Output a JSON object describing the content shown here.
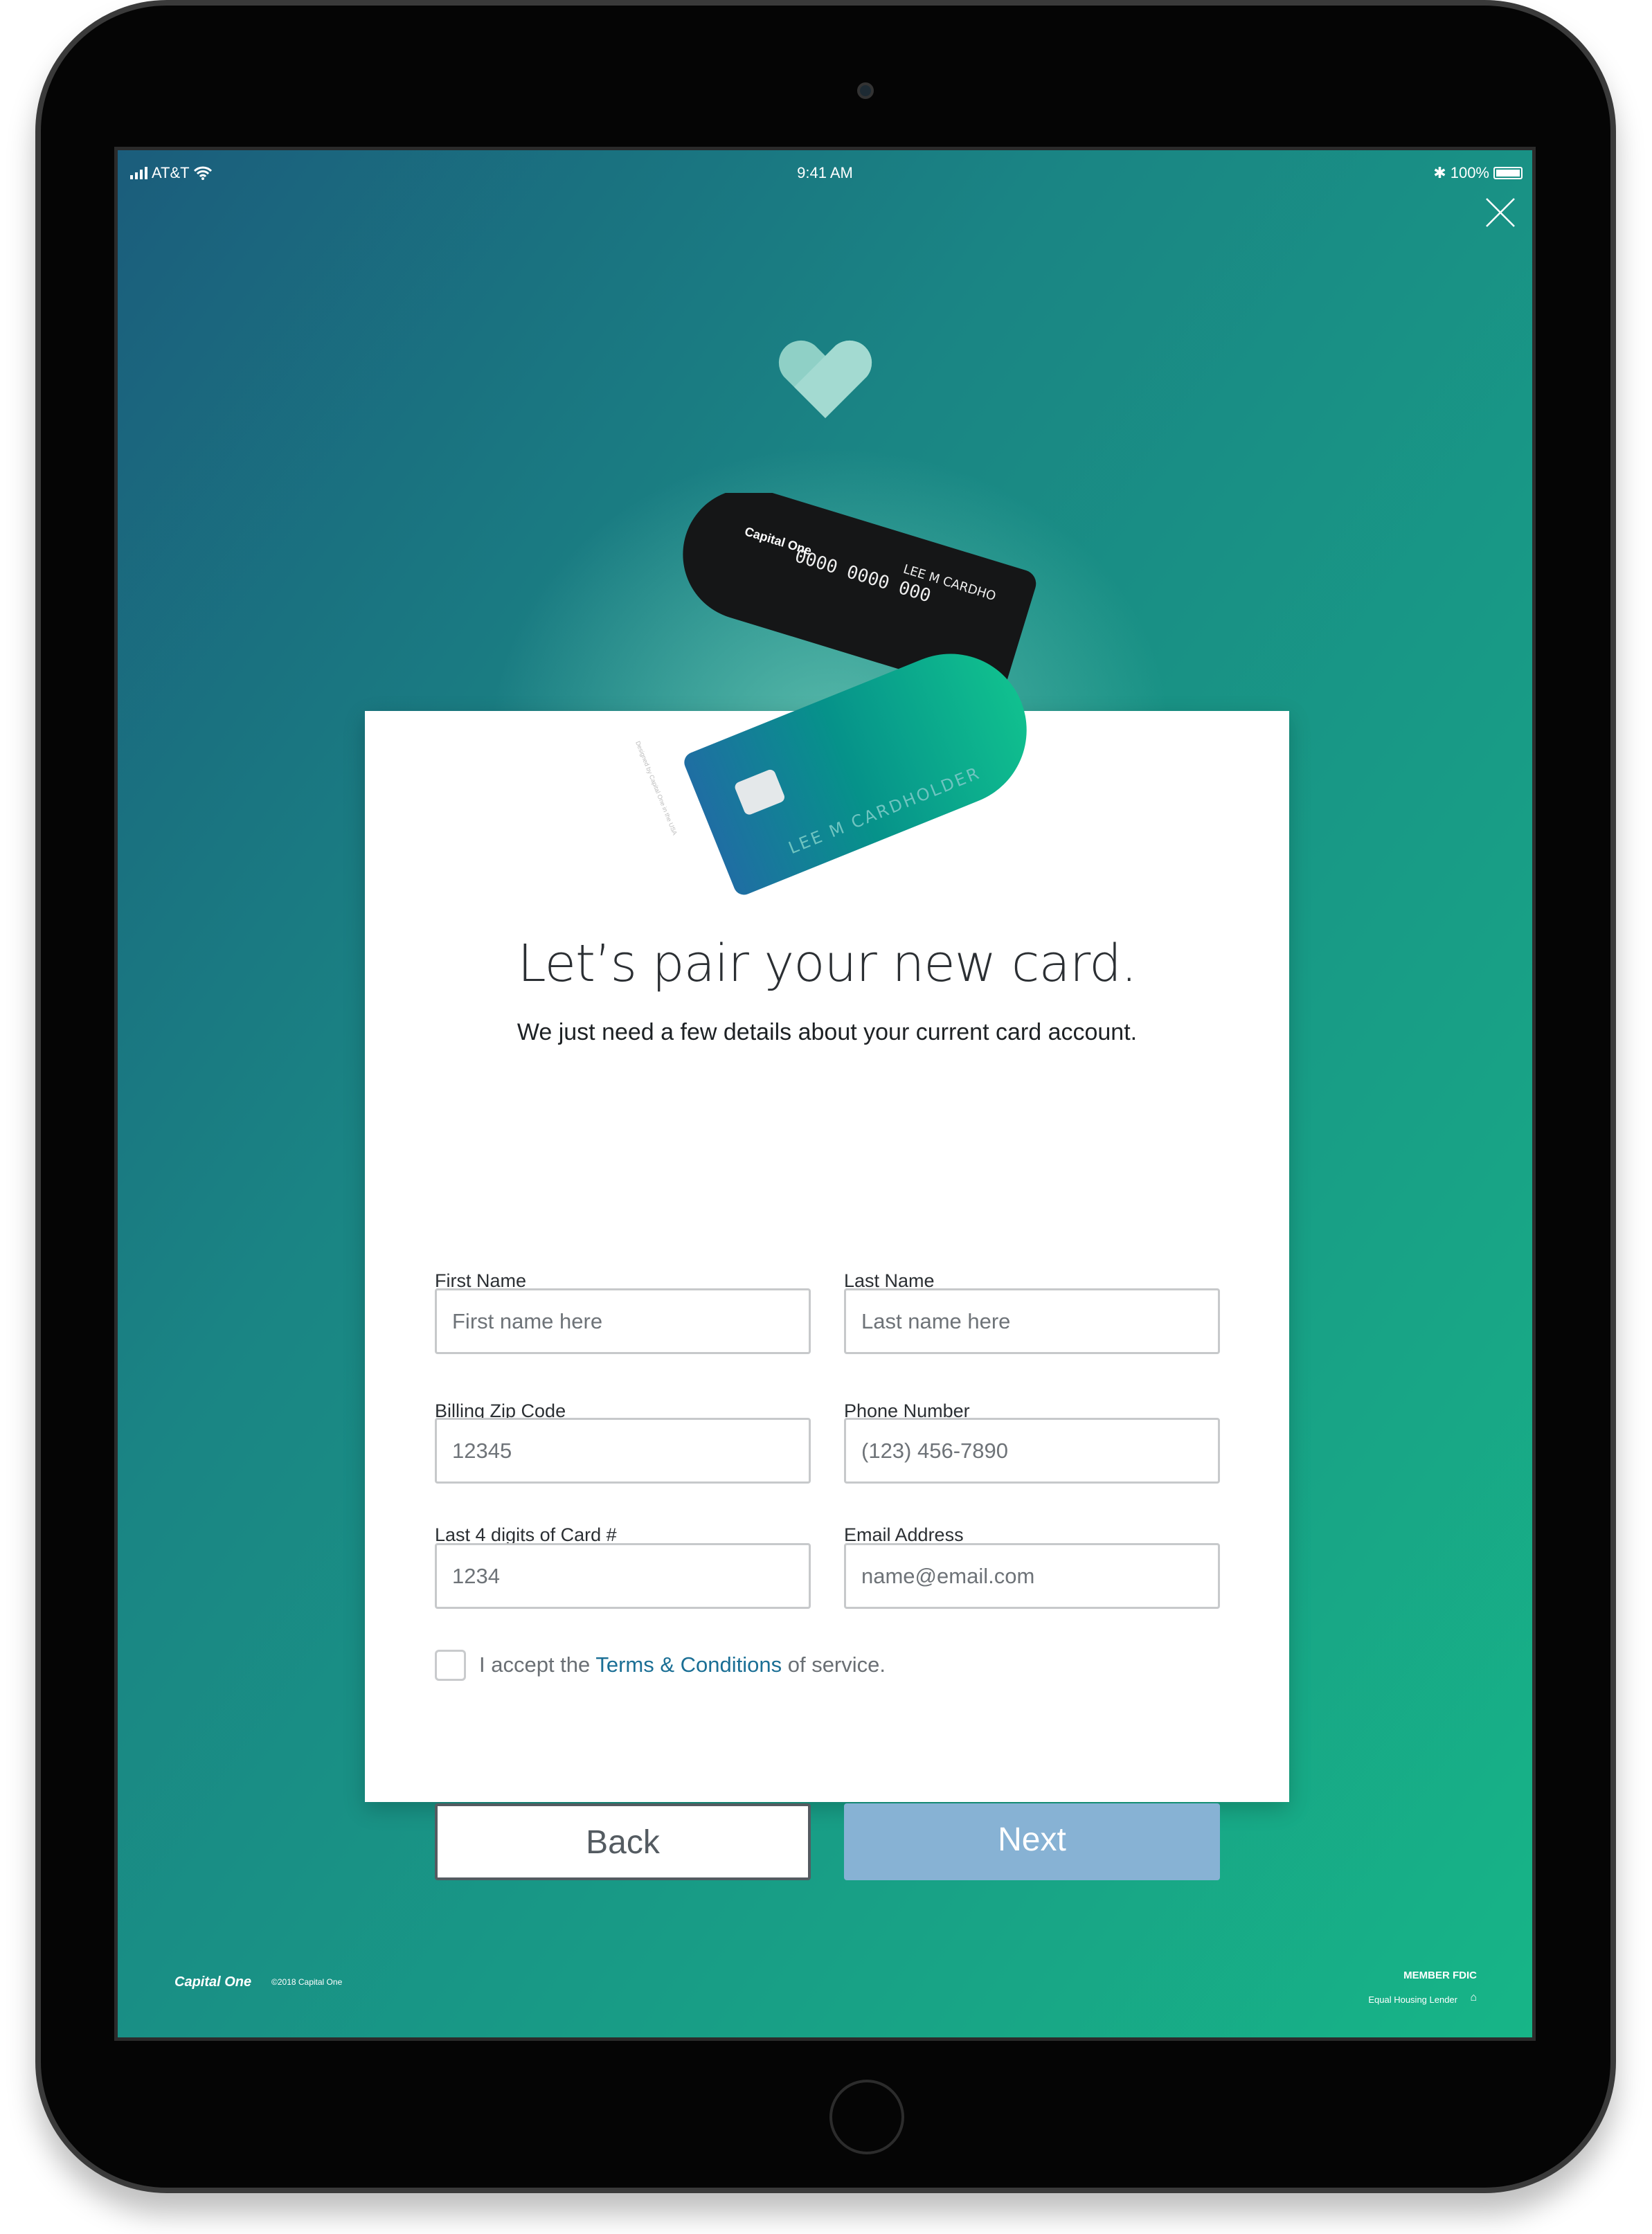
{
  "status_bar": {
    "carrier": "AT&T",
    "time": "9:41 AM",
    "battery": "100%"
  },
  "icons": {
    "close": "close-icon",
    "heart": "heart-icon"
  },
  "cards": {
    "back_card": {
      "brand": "Capital One",
      "number": "0000 0000 000",
      "name": "LEE M CARDHO",
      "side_text": "Designed by Capital One in the USA"
    },
    "front_card": {
      "name": "LEE M CARDHOLDER"
    }
  },
  "form": {
    "title": "Let’s pair your new card.",
    "subtitle": "We just need a few details about your current card account.",
    "fields": [
      {
        "label": "First Name",
        "placeholder": "First name here"
      },
      {
        "label": "Last Name",
        "placeholder": "Last name here"
      },
      {
        "label": "Billing Zip Code",
        "placeholder": "12345"
      },
      {
        "label": "Phone Number",
        "placeholder": "(123) 456-7890"
      },
      {
        "label": "Last 4 digits of Card #",
        "placeholder": "1234"
      },
      {
        "label": "Email Address",
        "placeholder": "name@email.com"
      }
    ],
    "terms": {
      "prefix": "I accept the ",
      "link": "Terms & Conditions",
      "suffix": " of service.",
      "checked": false
    },
    "back_label": "Back",
    "next_label": "Next"
  },
  "footer": {
    "logo": "Capital One",
    "copyright": "©2018 Capital One",
    "fdic": "MEMBER FDIC",
    "housing": "Equal Housing Lender"
  },
  "colors": {
    "next_button": "#87b2d4",
    "link": "#1b6f95",
    "bg_start": "#1b5d7c",
    "bg_end": "#17b587"
  }
}
